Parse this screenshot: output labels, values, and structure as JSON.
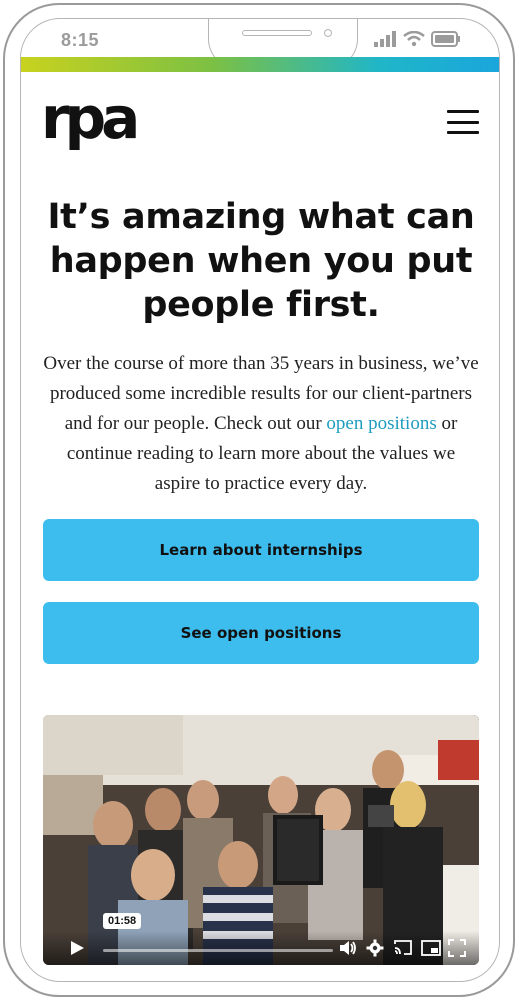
{
  "status_bar": {
    "time": "8:15"
  },
  "header": {
    "logo_text": "rpa",
    "menu_icon": "hamburger-icon"
  },
  "hero": {
    "headline": "It’s amazing what can happen when you put people first.",
    "body_before_link": "Over the course of more than 35 years in business, we’ve produced some incredible results for our client-partners and for our people. Check out our ",
    "link_text": "open positions",
    "body_after_link": " or continue reading to learn more about the values we aspire to practice every day."
  },
  "buttons": {
    "internships": "Learn about internships",
    "positions": "See open positions"
  },
  "video": {
    "time_badge": "01:58",
    "controls": [
      "play-icon",
      "volume-icon",
      "gear-icon",
      "cast-icon",
      "picture-in-picture-icon",
      "fullscreen-icon"
    ]
  },
  "colors": {
    "accent_button": "#3dbdee",
    "link": "#1e9cbf",
    "gradient": [
      "#c8d21e",
      "#7cc043",
      "#20b6c8",
      "#1aa6dc"
    ]
  }
}
